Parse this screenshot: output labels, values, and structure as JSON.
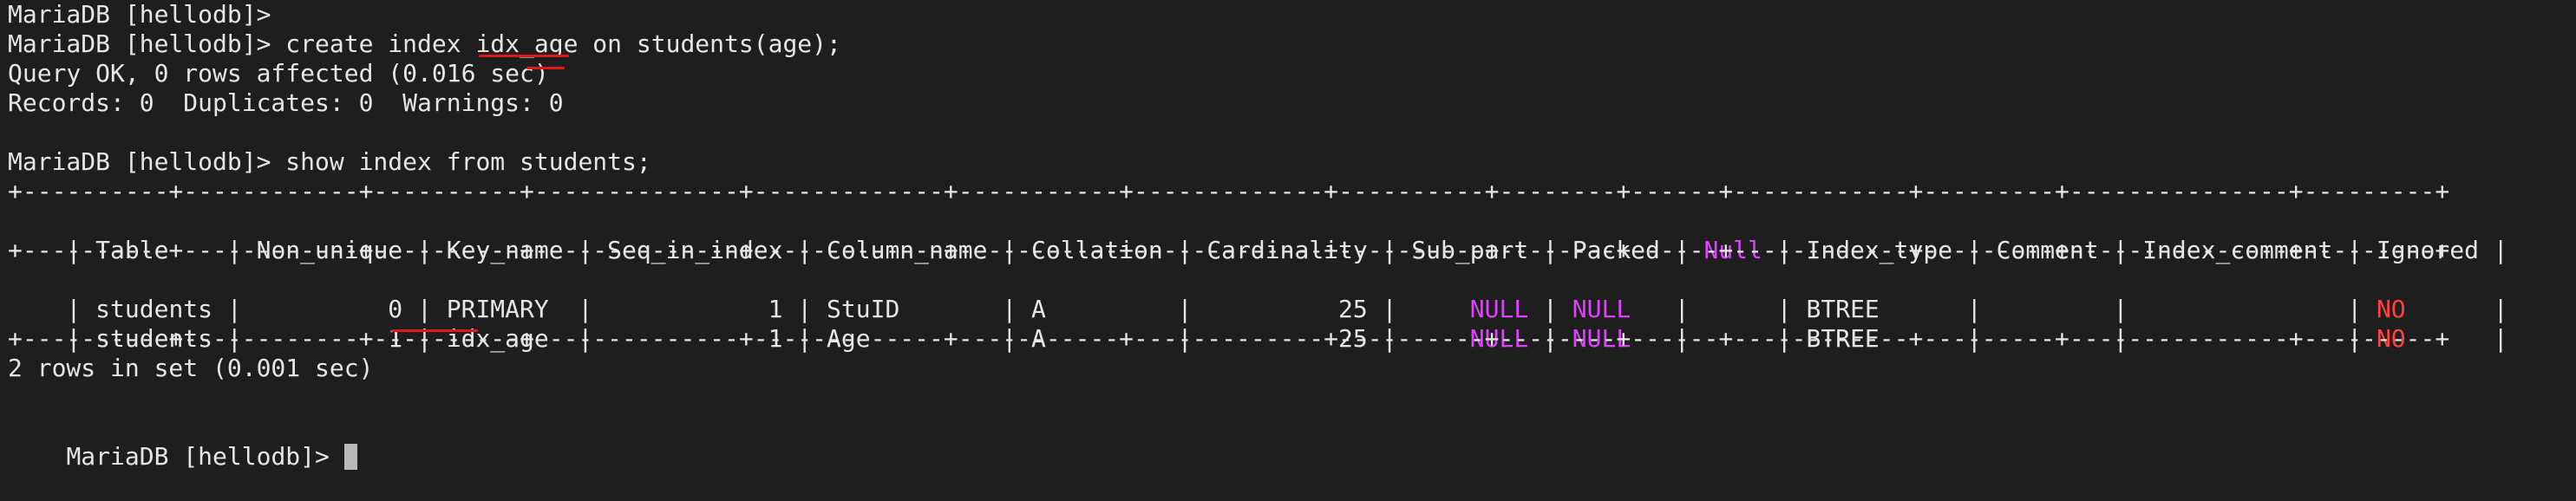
{
  "terminal": {
    "lines": [
      "MariaDB [hellodb]>",
      "MariaDB [hellodb]> create index idx_age on students(age);",
      "Query OK, 0 rows affected (0.016 sec)",
      "Records: 0  Duplicates: 0  Warnings: 0",
      "",
      "MariaDB [hellodb]> show index from students;"
    ],
    "table": {
      "border": "+----------+------------+----------+--------------+-------------+-----------+-------------+----------+--------+------+------------+---------+---------------+---------+",
      "header": [
        {
          "t": "| Table    | Non_unique | Key_name | Seq_in_index | Column_name | Collation | Cardinality | Sub_part | Packed | "
        },
        {
          "t": "Null",
          "c": "null"
        },
        {
          "t": " | Index_type | Comment | Index_comment | Ignored |"
        }
      ],
      "rows": [
        [
          {
            "t": "| students |          0 | PRIMARY  |            1 | StuID       | A         |          25 |     "
          },
          {
            "t": "NULL",
            "c": "null"
          },
          {
            "t": " | "
          },
          {
            "t": "NULL",
            "c": "null"
          },
          {
            "t": "   |      | BTREE      |         |               | "
          },
          {
            "t": "NO",
            "c": "red"
          },
          {
            "t": "      |"
          }
        ],
        [
          {
            "t": "| students |          1 | idx_age  |            1 | Age         | A         |          25 |     "
          },
          {
            "t": "NULL",
            "c": "null"
          },
          {
            "t": " | "
          },
          {
            "t": "NULL",
            "c": "null"
          },
          {
            "t": "   |      | BTREE      |         |               | "
          },
          {
            "t": "NO",
            "c": "red"
          },
          {
            "t": "      |"
          }
        ]
      ]
    },
    "result_line": "2 rows in set (0.001 sec)",
    "prompt": "MariaDB [hellodb]> "
  },
  "colors": {
    "background": "#1e1e1e",
    "text": "#e6e6e6",
    "null_value": "#e040ff",
    "no_value": "#ff4040",
    "annotation": "#e01818"
  }
}
